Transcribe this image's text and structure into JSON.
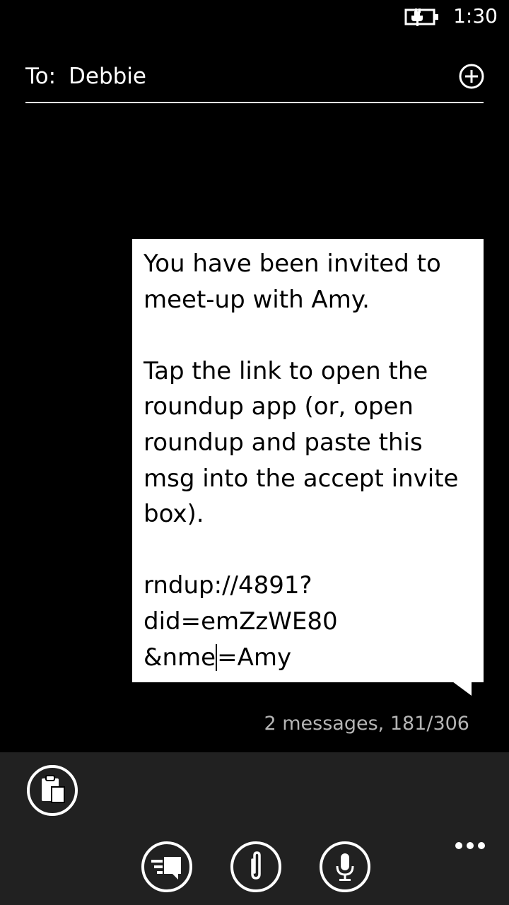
{
  "status_bar": {
    "time": "1:30",
    "battery_icon": "battery-charging-icon"
  },
  "compose": {
    "to_label": "To:",
    "recipient": "Debbie",
    "add_icon": "add-circle-icon"
  },
  "message": {
    "lines": [
      "You have been invited to",
      "meet-up with Amy.",
      "",
      "Tap the link to open the",
      "roundup app (or, open",
      "roundup and paste this",
      "msg into the accept invite",
      "box).",
      "",
      "rndup://4891?",
      "did=emZzWE80"
    ],
    "last_line_before_cursor": "&nme",
    "last_line_after_cursor": "=Amy",
    "count": "2 messages, 181/306"
  },
  "app_bar": {
    "buttons": [
      {
        "name": "paste",
        "icon": "paste-icon"
      },
      {
        "name": "send",
        "icon": "send-icon"
      },
      {
        "name": "attach",
        "icon": "paperclip-icon"
      },
      {
        "name": "voice",
        "icon": "microphone-icon"
      }
    ],
    "more_icon": "ellipsis-icon"
  },
  "colors": {
    "background": "#000000",
    "app_bar": "#212121",
    "bubble": "#ffffff",
    "count_text": "#b5b5b5"
  }
}
